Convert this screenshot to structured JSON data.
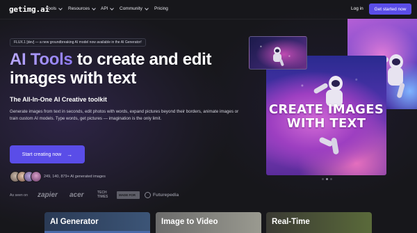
{
  "nav": {
    "logo": "getimg.ai",
    "items": [
      {
        "label": "Tools",
        "has_dropdown": true
      },
      {
        "label": "Resources",
        "has_dropdown": true
      },
      {
        "label": "API",
        "has_dropdown": true
      },
      {
        "label": "Community",
        "has_dropdown": true
      },
      {
        "label": "Pricing",
        "has_dropdown": false
      }
    ],
    "login_label": "Log in",
    "cta_label": "Get started now"
  },
  "hero": {
    "banner": "FLUX.1 [dev] — a new groundbreaking AI model now available in the AI Generator!",
    "headline_accent": "AI Tools",
    "headline_rest": " to create and edit images with text",
    "subheading": "The All-In-One AI Creative toolkit",
    "description": "Generate images from text in seconds, edit photos with words, expand pictures beyond their borders, animate images or train custom AI models. Type words, get pictures — imagination is the only limit.",
    "cta_label": "Start creating now",
    "cta_arrow": "→",
    "counter_text": "249, 140, 879+ AI generated images",
    "as_seen_on_label": "As seen on",
    "brands": [
      "zapier",
      "acer",
      "TECH TIMES",
      "MADE FOR",
      "Futurepedia"
    ]
  },
  "showcase": {
    "main_image_text": "CREATE IMAGES WITH TEXT",
    "carousel_dots": 3,
    "active_dot": 1
  },
  "features": [
    {
      "label": "AI Generator"
    },
    {
      "label": "Image to Video"
    },
    {
      "label": "Real-Time"
    }
  ],
  "colors": {
    "accent": "#5a4de8",
    "headline_accent": "#a898ff",
    "background": "#17171b"
  }
}
